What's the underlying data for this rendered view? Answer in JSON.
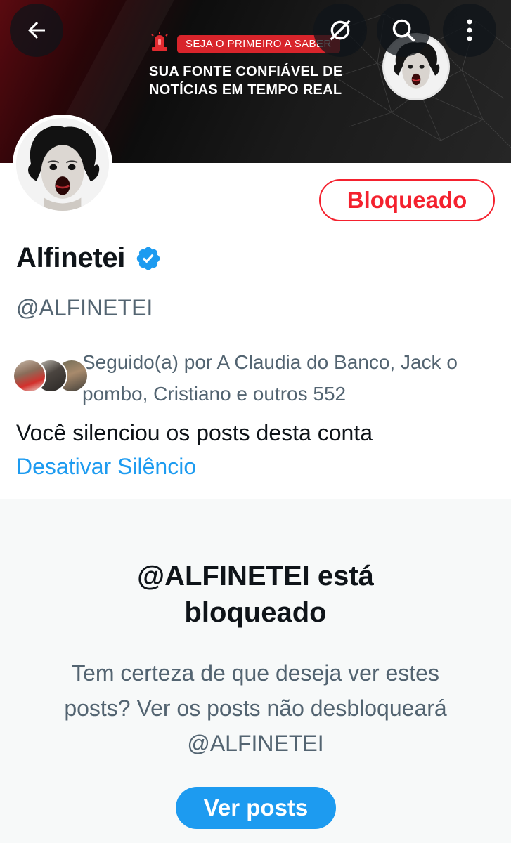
{
  "banner": {
    "tag": "SEJA O PRIMEIRO A SABER",
    "line1": "SUA FONTE CONFIÁVEL DE",
    "line2": "NOTÍCIAS EM TEMPO REAL"
  },
  "toolbar": {
    "back_icon": "arrow-left-icon",
    "nosync_icon": "satellite-off-icon",
    "search_icon": "search-icon",
    "more_icon": "more-vertical-icon"
  },
  "profile": {
    "name": "Alfinetei",
    "handle": "@ALFINETEI",
    "verified": true,
    "blocked_label": "Bloqueado",
    "followers_text": "Seguido(a) por A Claudia do Banco, Jack o pombo, Cristiano e outros 552",
    "muted_text": "Você silenciou os posts desta conta",
    "unmute_label": "Desativar Silêncio"
  },
  "blocked_panel": {
    "title_line1": "@ALFINETEI está",
    "title_line2": "bloqueado",
    "description": "Tem certeza de que deseja ver estes posts? Ver os posts não desbloqueará @ALFINETEI",
    "button_label": "Ver posts"
  },
  "colors": {
    "accent": "#1d9bf0",
    "blocked_red": "#f4212e",
    "secondary_text": "#536471",
    "banner_red": "#d8242b"
  }
}
